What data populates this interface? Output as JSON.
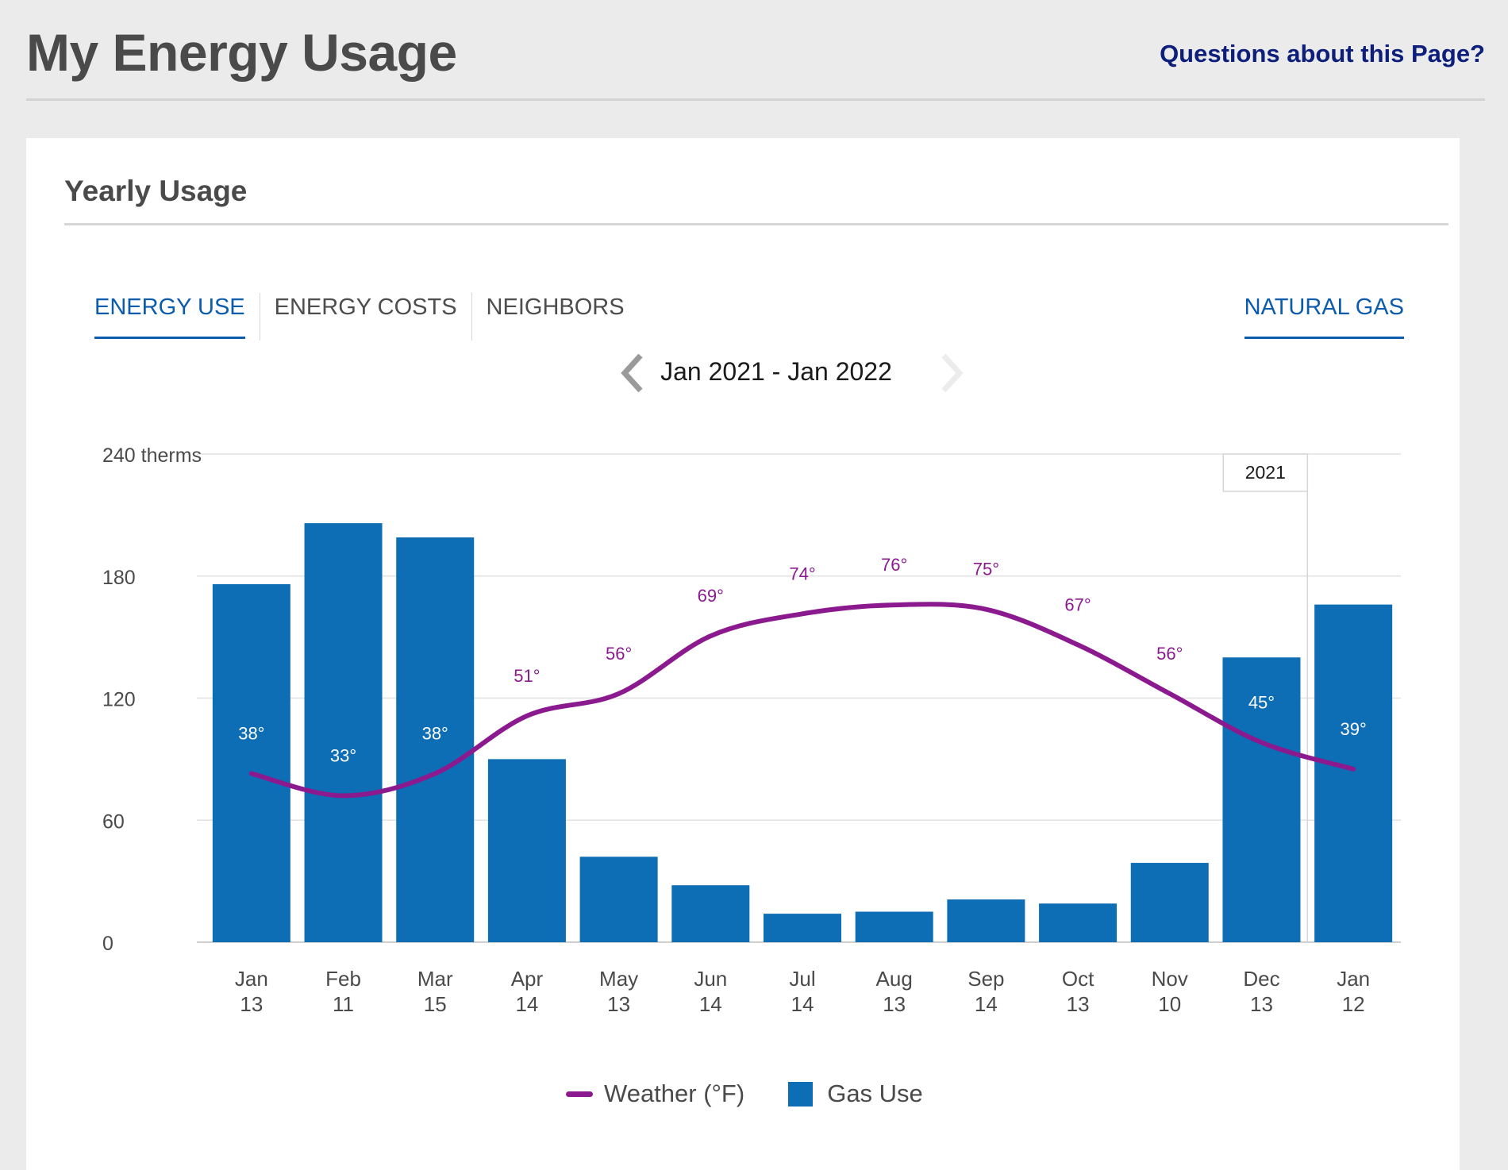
{
  "header": {
    "title": "My Energy Usage",
    "help_link": "Questions about this Page?"
  },
  "card": {
    "title": "Yearly Usage",
    "tabs": [
      {
        "label": "ENERGY USE",
        "active": true
      },
      {
        "label": "ENERGY COSTS",
        "active": false
      },
      {
        "label": "NEIGHBORS",
        "active": false
      }
    ],
    "fuel_tab": "NATURAL GAS",
    "date_range": "Jan 2021 - Jan 2022"
  },
  "legend": {
    "weather": "Weather (°F)",
    "gas": "Gas Use"
  },
  "colors": {
    "bar": "#0d6db5",
    "weather_line": "#8b1a8f",
    "active_tab": "#0b5cad"
  },
  "chart_data": {
    "type": "bar",
    "ylabel": "therms",
    "ylim": [
      0,
      240
    ],
    "yticks": [
      0,
      60,
      120,
      180,
      240
    ],
    "ytick_labels": [
      "0",
      "60",
      "120",
      "180",
      "240 therms"
    ],
    "categories": [
      [
        "Jan",
        "13"
      ],
      [
        "Feb",
        "11"
      ],
      [
        "Mar",
        "15"
      ],
      [
        "Apr",
        "14"
      ],
      [
        "May",
        "13"
      ],
      [
        "Jun",
        "14"
      ],
      [
        "Jul",
        "14"
      ],
      [
        "Aug",
        "13"
      ],
      [
        "Sep",
        "14"
      ],
      [
        "Oct",
        "13"
      ],
      [
        "Nov",
        "10"
      ],
      [
        "Dec",
        "13"
      ],
      [
        "Jan",
        "12"
      ]
    ],
    "series": [
      {
        "name": "Gas Use",
        "type": "bar",
        "values": [
          176,
          206,
          199,
          90,
          42,
          28,
          14,
          15,
          21,
          19,
          39,
          140,
          166
        ]
      },
      {
        "name": "Weather (°F)",
        "type": "line",
        "values": [
          38,
          33,
          38,
          51,
          56,
          69,
          74,
          76,
          75,
          67,
          56,
          45,
          39
        ],
        "labels": [
          "38°",
          "33°",
          "38°",
          "51°",
          "56°",
          "69°",
          "74°",
          "76°",
          "75°",
          "67°",
          "56°",
          "45°",
          "39°"
        ]
      }
    ],
    "year_marker": {
      "label": "2021",
      "between": [
        11,
        12
      ]
    },
    "grid": true
  }
}
